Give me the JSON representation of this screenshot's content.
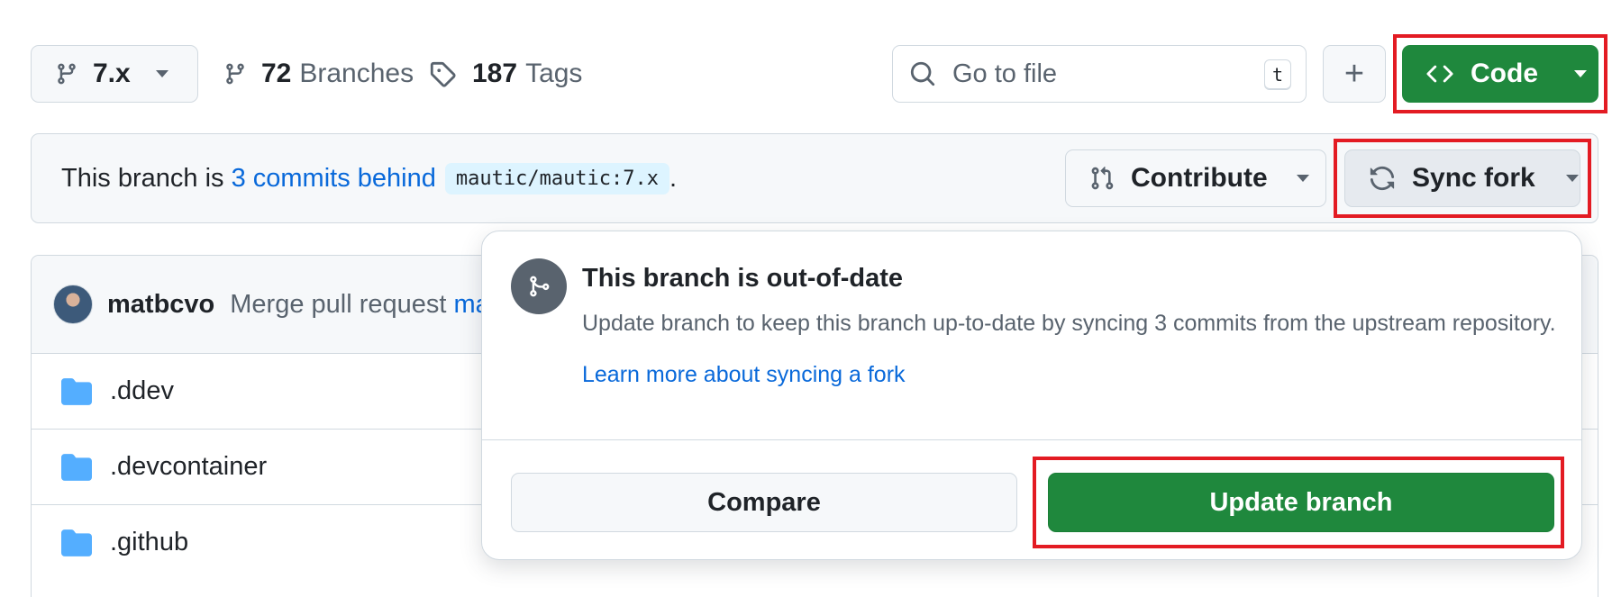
{
  "toolbar": {
    "branch_label": "7.x",
    "branches_count": "72",
    "branches_label": "Branches",
    "tags_count": "187",
    "tags_label": "Tags",
    "search_placeholder": "Go to file",
    "search_shortcut": "t",
    "add_label": "+",
    "code_label": "Code"
  },
  "banner": {
    "prefix": "This branch is ",
    "commits_link": "3 commits behind",
    "upstream_ref": "mautic/mautic:7.x",
    "suffix": ".",
    "contribute_label": "Contribute",
    "sync_fork_label": "Sync fork"
  },
  "commit": {
    "author": "matbcvo",
    "message": "Merge pull request ",
    "message_link": "ma"
  },
  "files": [
    {
      "name": ".ddev"
    },
    {
      "name": ".devcontainer"
    },
    {
      "name": ".github"
    }
  ],
  "popup": {
    "title": "This branch is out-of-date",
    "description": "Update branch to keep this branch up-to-date by syncing 3 commits from the upstream repository.",
    "learn_more": "Learn more about syncing a fork",
    "compare_label": "Compare",
    "update_label": "Update branch"
  },
  "colors": {
    "primary_green": "#1f883d",
    "link_blue": "#0969da",
    "highlight_red": "#e31b23",
    "folder_blue": "#54aeff"
  },
  "icons": [
    "git-branch-icon",
    "tag-icon",
    "search-icon",
    "code-icon",
    "git-pull-request-icon",
    "sync-icon",
    "git-merge-icon",
    "folder-icon",
    "triangle-down-icon"
  ]
}
